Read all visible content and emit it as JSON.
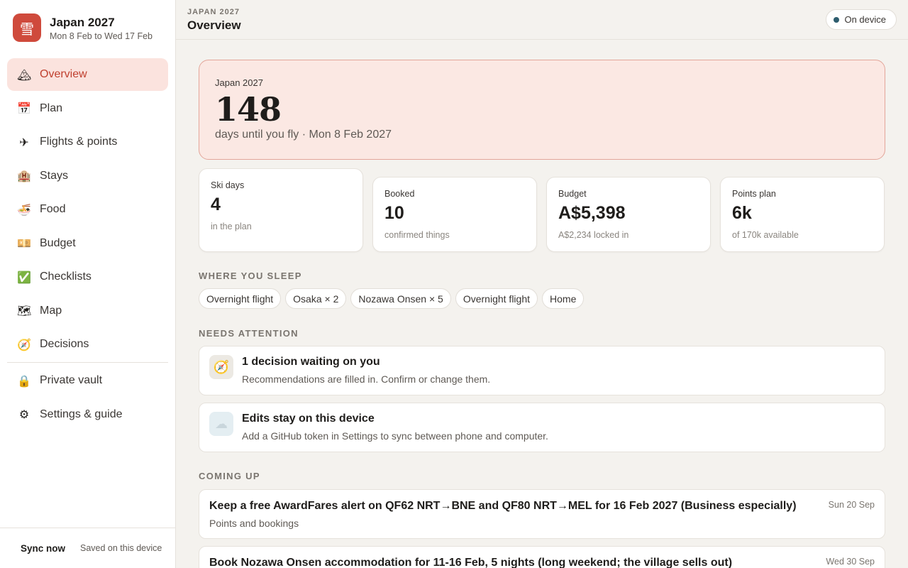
{
  "brand": {
    "logo_glyph": "雪",
    "title": "Japan 2027",
    "subtitle": "Mon 8 Feb to Wed 17 Feb",
    "color": "#cf4a3c"
  },
  "nav": {
    "items": [
      {
        "icon": "mountain-icon",
        "glyph": "🏔",
        "label": "Overview",
        "active": true
      },
      {
        "icon": "calendar-icon",
        "glyph": "📅",
        "label": "Plan"
      },
      {
        "icon": "airplane-icon",
        "glyph": "✈",
        "label": "Flights & points"
      },
      {
        "icon": "hotel-icon",
        "glyph": "🏨",
        "label": "Stays"
      },
      {
        "icon": "noodle-bowl-icon",
        "glyph": "🍜",
        "label": "Food"
      },
      {
        "icon": "money-icon",
        "glyph": "💴",
        "label": "Budget"
      },
      {
        "icon": "check-box-icon",
        "glyph": "✅",
        "label": "Checklists"
      },
      {
        "icon": "map-icon",
        "glyph": "🗺",
        "label": "Map"
      },
      {
        "icon": "compass-icon",
        "glyph": "🧭",
        "label": "Decisions"
      }
    ],
    "secondary": [
      {
        "icon": "lock-icon",
        "glyph": "🔒",
        "label": "Private vault"
      },
      {
        "icon": "gear-icon",
        "glyph": "⚙",
        "label": "Settings & guide"
      }
    ]
  },
  "footer": {
    "sync_label": "Sync now",
    "saved_text": "Saved on this device"
  },
  "header": {
    "crumb": "JAPAN 2027",
    "title": "Overview",
    "status": "On device",
    "status_color": "#2e5d6e"
  },
  "hero": {
    "label": "Japan 2027",
    "count": "148",
    "subtitle": "days until you fly · Mon 8 Feb 2027"
  },
  "stats": [
    {
      "label": "Ski days",
      "value": "4",
      "sub": "in the plan"
    },
    {
      "label": "Booked",
      "value": "10",
      "sub": "confirmed things"
    },
    {
      "label": "Budget",
      "value": "A$5,398",
      "sub": "A$2,234 locked in"
    },
    {
      "label": "Points plan",
      "value": "6k",
      "sub": "of 170k available"
    }
  ],
  "sleep": {
    "title": "WHERE YOU SLEEP",
    "chips": [
      "Overnight flight",
      "Osaka × 2",
      "Nozawa Onsen × 5",
      "Overnight flight",
      "Home"
    ]
  },
  "attention": {
    "title": "NEEDS ATTENTION",
    "items": [
      {
        "icon": "compass-icon",
        "glyph": "🧭",
        "title": "1 decision waiting on you",
        "sub": "Recommendations are filled in. Confirm or change them."
      },
      {
        "icon": "cloud-icon",
        "glyph": "☁",
        "title": "Edits stay on this device",
        "sub": "Add a GitHub token in Settings to sync between phone and computer."
      }
    ]
  },
  "coming_up": {
    "title": "COMING UP",
    "items": [
      {
        "title": "Keep a free AwardFares alert on QF62 NRT→BNE and QF80 NRT→MEL for 16 Feb 2027 (Business especially)",
        "sub": "Points and bookings",
        "date": "Sun 20 Sep"
      },
      {
        "title": "Book Nozawa Onsen accommodation for 11-16 Feb, 5 nights (long weekend; the village sells out)",
        "sub": "",
        "date": "Wed 30 Sep"
      }
    ]
  }
}
